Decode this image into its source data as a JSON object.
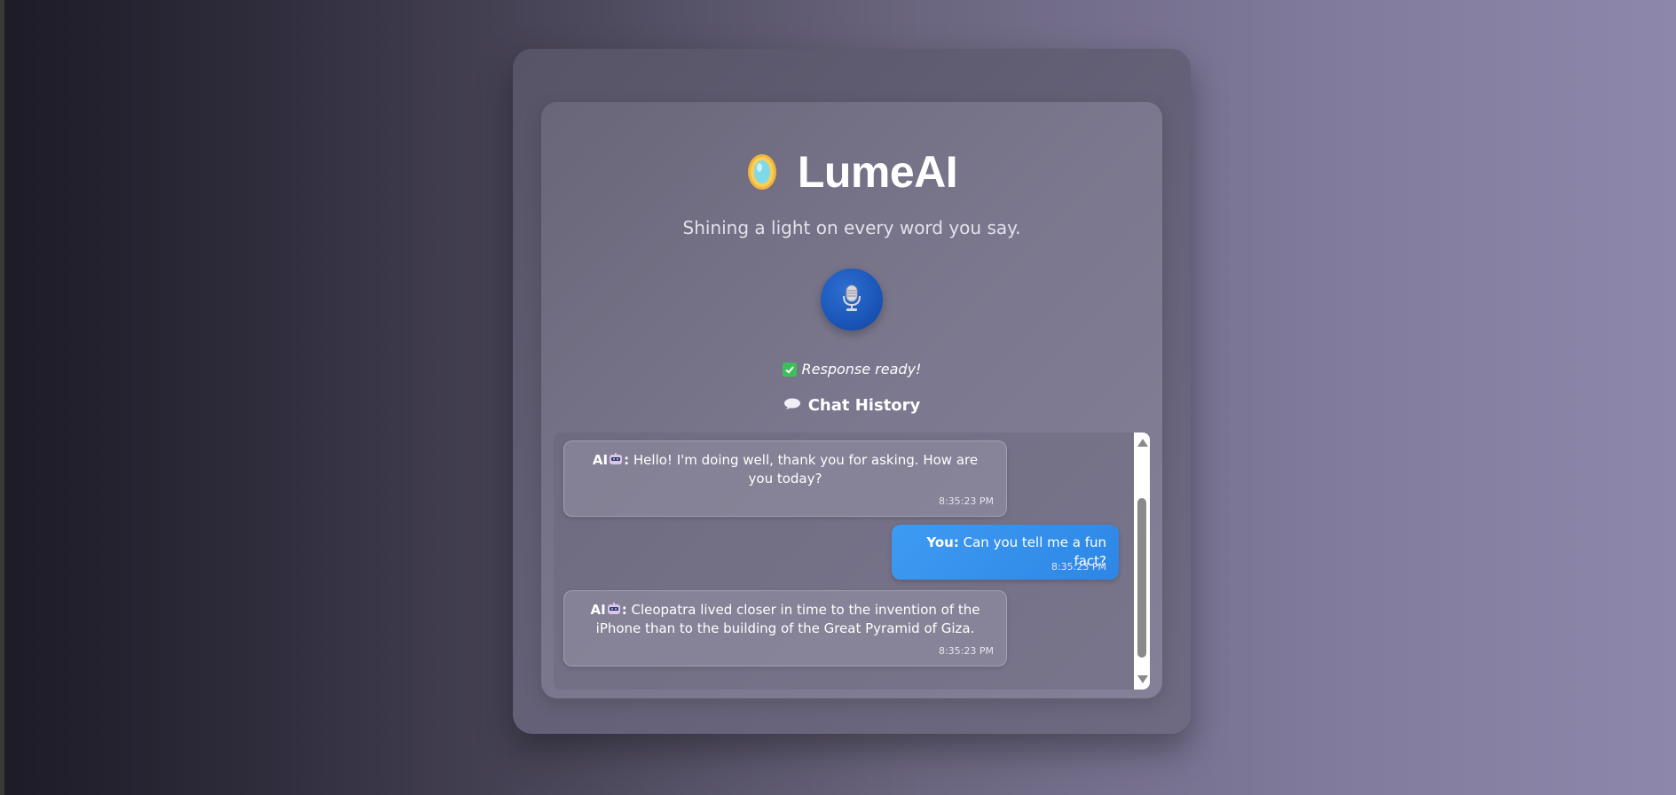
{
  "app": {
    "title": "LumeAI",
    "tagline": "Shining a light on every word you say.",
    "brand_icon": "lamp-icon"
  },
  "controls": {
    "mic_icon": "microphone-icon"
  },
  "status": {
    "icon": "check-icon",
    "text": "Response ready!"
  },
  "history": {
    "icon": "speech-bubble-icon",
    "title": "Chat History"
  },
  "messages": [
    {
      "role": "ai",
      "sender": "AI",
      "sender_icon": "robot-icon",
      "separator": ":",
      "text": "Hello! I'm doing well, thank you for asking. How are you today?",
      "time": "8:35:23 PM"
    },
    {
      "role": "user",
      "sender": "You:",
      "text": "Can you tell me a fun fact?",
      "time": "8:35:23 PM"
    },
    {
      "role": "ai",
      "sender": "AI",
      "sender_icon": "robot-icon",
      "separator": ":",
      "text": "Cleopatra lived closer in time to the invention of the iPhone than to the building of the Great Pyramid of Giza.",
      "time": "8:35:23 PM"
    }
  ],
  "colors": {
    "accent_blue": "#2d86e5",
    "mic_blue": "#1a56b8",
    "status_green": "#3fbf5a"
  }
}
